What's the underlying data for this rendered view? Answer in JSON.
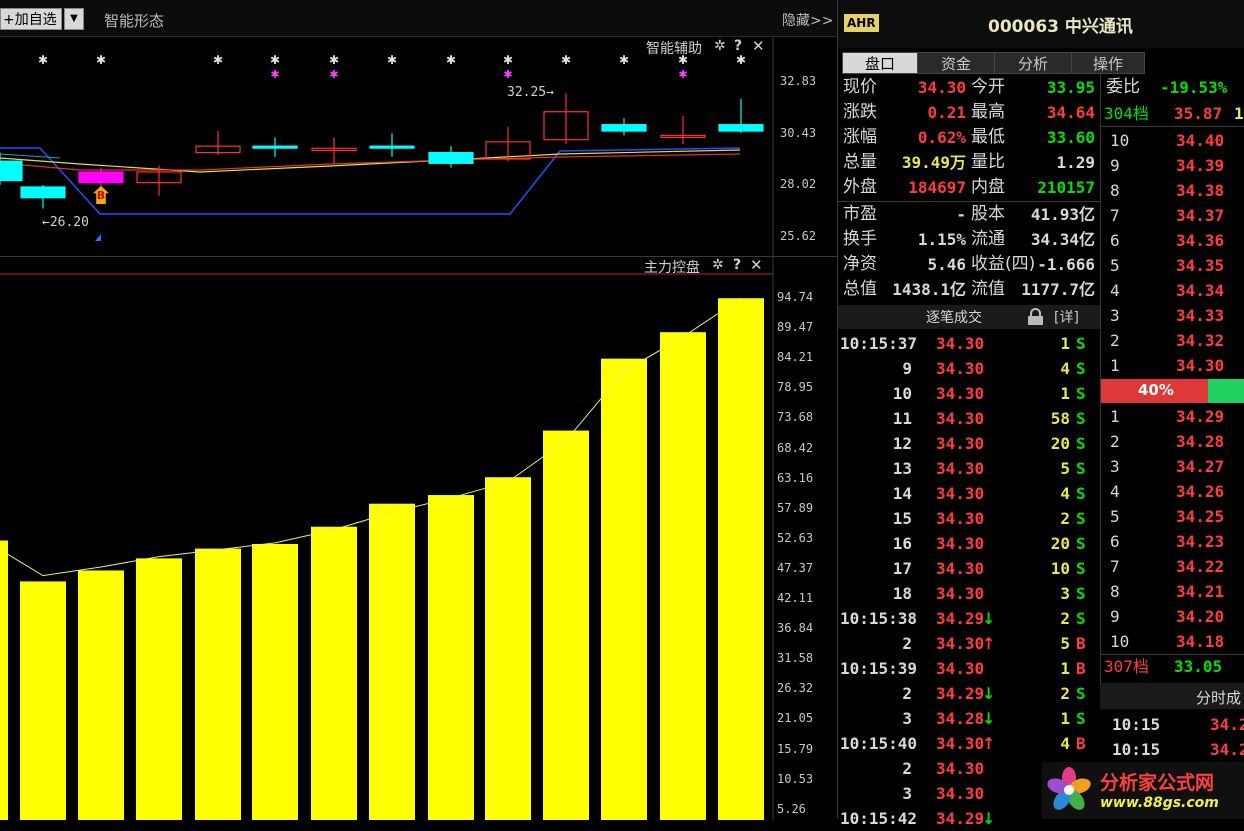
{
  "toolbar": {
    "add_label": "加自选",
    "add_plus": "+",
    "dropdown": "▼",
    "smart_shape": "智能形态",
    "hide": "隐藏>>"
  },
  "kline": {
    "title": "智能辅助",
    "axis": [
      "32.83",
      "30.43",
      "28.02",
      "25.62"
    ],
    "annot_high": "32.25→",
    "annot_low": "←26.20",
    "b_marker": "B"
  },
  "volume": {
    "title": "主力控盘",
    "axis": [
      "94.74",
      "89.47",
      "84.21",
      "78.95",
      "73.68",
      "68.42",
      "63.16",
      "57.89",
      "52.63",
      "47.37",
      "42.11",
      "36.84",
      "31.58",
      "26.32",
      "21.05",
      "15.79",
      "10.53",
      "5.26"
    ]
  },
  "chart_data": {
    "type": "bar",
    "title": "主力控盘",
    "values": [
      52.6,
      45.5,
      47.4,
      49.5,
      51.2,
      52.0,
      55.0,
      59.0,
      60.5,
      63.6,
      71.7,
      84.2,
      88.8,
      94.7
    ],
    "line": [
      52.6,
      46.5,
      48.0,
      49.8,
      51.0,
      52.2,
      54.5,
      57.5,
      60.0,
      62.8,
      70.0,
      82.0,
      88.0,
      94.7
    ],
    "ylim": [
      5.26,
      94.74
    ]
  },
  "stock": {
    "badge": "AHR",
    "title": "000063 中兴通讯"
  },
  "tabs": [
    "盘口",
    "资金",
    "分析",
    "操作"
  ],
  "quote": [
    {
      "l1": "现价",
      "v1": "34.30",
      "c1": "red",
      "l2": "今开",
      "v2": "33.95",
      "c2": "green"
    },
    {
      "l1": "涨跌",
      "v1": "0.21",
      "c1": "red",
      "l2": "最高",
      "v2": "34.64",
      "c2": "red"
    },
    {
      "l1": "涨幅",
      "v1": "0.62%",
      "c1": "red",
      "l2": "最低",
      "v2": "33.60",
      "c2": "green"
    },
    {
      "l1": "总量",
      "v1": "39.49万",
      "c1": "yel",
      "l2": "量比",
      "v2": "1.29",
      "c2": "wht"
    },
    {
      "l1": "外盘",
      "v1": "184697",
      "c1": "red",
      "l2": "内盘",
      "v2": "210157",
      "c2": "green"
    },
    {
      "l1": "市盈",
      "v1": "-",
      "c1": "wht",
      "l2": "股本",
      "v2": "41.93亿",
      "c2": "wht"
    },
    {
      "l1": "换手",
      "v1": "1.15%",
      "c1": "wht",
      "l2": "流通",
      "v2": "34.34亿",
      "c2": "wht"
    },
    {
      "l1": "净资",
      "v1": "5.46",
      "c1": "wht",
      "l2": "收益(四)",
      "v2": "-1.666",
      "c2": "wht"
    },
    {
      "l1": "总值",
      "v1": "1438.1亿",
      "c1": "wht",
      "l2": "流值",
      "v2": "1177.7亿",
      "c2": "wht"
    }
  ],
  "ticks_header": {
    "label": "逐笔成交",
    "detail": "[详]"
  },
  "ticks": [
    {
      "t": "10:15:37",
      "p": "34.30",
      "a": "",
      "v": "1",
      "s": "S"
    },
    {
      "t": "9",
      "p": "34.30",
      "a": "",
      "v": "4",
      "s": "S"
    },
    {
      "t": "10",
      "p": "34.30",
      "a": "",
      "v": "1",
      "s": "S"
    },
    {
      "t": "11",
      "p": "34.30",
      "a": "",
      "v": "58",
      "s": "S"
    },
    {
      "t": "12",
      "p": "34.30",
      "a": "",
      "v": "20",
      "s": "S"
    },
    {
      "t": "13",
      "p": "34.30",
      "a": "",
      "v": "5",
      "s": "S"
    },
    {
      "t": "14",
      "p": "34.30",
      "a": "",
      "v": "4",
      "s": "S"
    },
    {
      "t": "15",
      "p": "34.30",
      "a": "",
      "v": "2",
      "s": "S"
    },
    {
      "t": "16",
      "p": "34.30",
      "a": "",
      "v": "20",
      "s": "S"
    },
    {
      "t": "17",
      "p": "34.30",
      "a": "",
      "v": "10",
      "s": "S"
    },
    {
      "t": "18",
      "p": "34.30",
      "a": "",
      "v": "3",
      "s": "S"
    },
    {
      "t": "10:15:38",
      "p": "34.29",
      "a": "↓",
      "v": "2",
      "s": "S"
    },
    {
      "t": "2",
      "p": "34.30",
      "a": "↑",
      "v": "5",
      "s": "B"
    },
    {
      "t": "10:15:39",
      "p": "34.30",
      "a": "",
      "v": "1",
      "s": "B"
    },
    {
      "t": "2",
      "p": "34.29",
      "a": "↓",
      "v": "2",
      "s": "S"
    },
    {
      "t": "3",
      "p": "34.28",
      "a": "↓",
      "v": "1",
      "s": "S"
    },
    {
      "t": "10:15:40",
      "p": "34.30",
      "a": "↑",
      "v": "4",
      "s": "B"
    },
    {
      "t": "2",
      "p": "34.30",
      "a": "",
      "v": "",
      "s": ""
    },
    {
      "t": "3",
      "p": "34.30",
      "a": "",
      "v": "",
      "s": ""
    },
    {
      "t": "10:15:42",
      "p": "34.29",
      "a": "↓",
      "v": "",
      "s": ""
    }
  ],
  "book": {
    "ratio_label": "委比",
    "ratio": "-19.53%",
    "ask_total_label": "304档",
    "ask_total_price": "35.87",
    "ask_total_extra": "1",
    "asks": [
      {
        "n": "10",
        "p": "34.40"
      },
      {
        "n": "9",
        "p": "34.39"
      },
      {
        "n": "8",
        "p": "34.38"
      },
      {
        "n": "7",
        "p": "34.37"
      },
      {
        "n": "6",
        "p": "34.36"
      },
      {
        "n": "5",
        "p": "34.35"
      },
      {
        "n": "4",
        "p": "34.34"
      },
      {
        "n": "3",
        "p": "34.33"
      },
      {
        "n": "2",
        "p": "34.32"
      },
      {
        "n": "1",
        "p": "34.30"
      }
    ],
    "pct": "40%",
    "bids": [
      {
        "n": "1",
        "p": "34.29"
      },
      {
        "n": "2",
        "p": "34.28"
      },
      {
        "n": "3",
        "p": "34.27"
      },
      {
        "n": "4",
        "p": "34.26"
      },
      {
        "n": "5",
        "p": "34.25"
      },
      {
        "n": "6",
        "p": "34.23"
      },
      {
        "n": "7",
        "p": "34.22"
      },
      {
        "n": "8",
        "p": "34.21"
      },
      {
        "n": "9",
        "p": "34.20"
      },
      {
        "n": "10",
        "p": "34.18"
      }
    ],
    "bid_total_label": "307档",
    "bid_total_price": "33.05",
    "minute_label": "分时成",
    "minute_rows": [
      {
        "t": "10:15",
        "p": "34.2"
      },
      {
        "t": "10:15",
        "p": "34.2"
      }
    ]
  },
  "watermark": {
    "site": "分析家公式网",
    "url": "www.88gs.com"
  }
}
